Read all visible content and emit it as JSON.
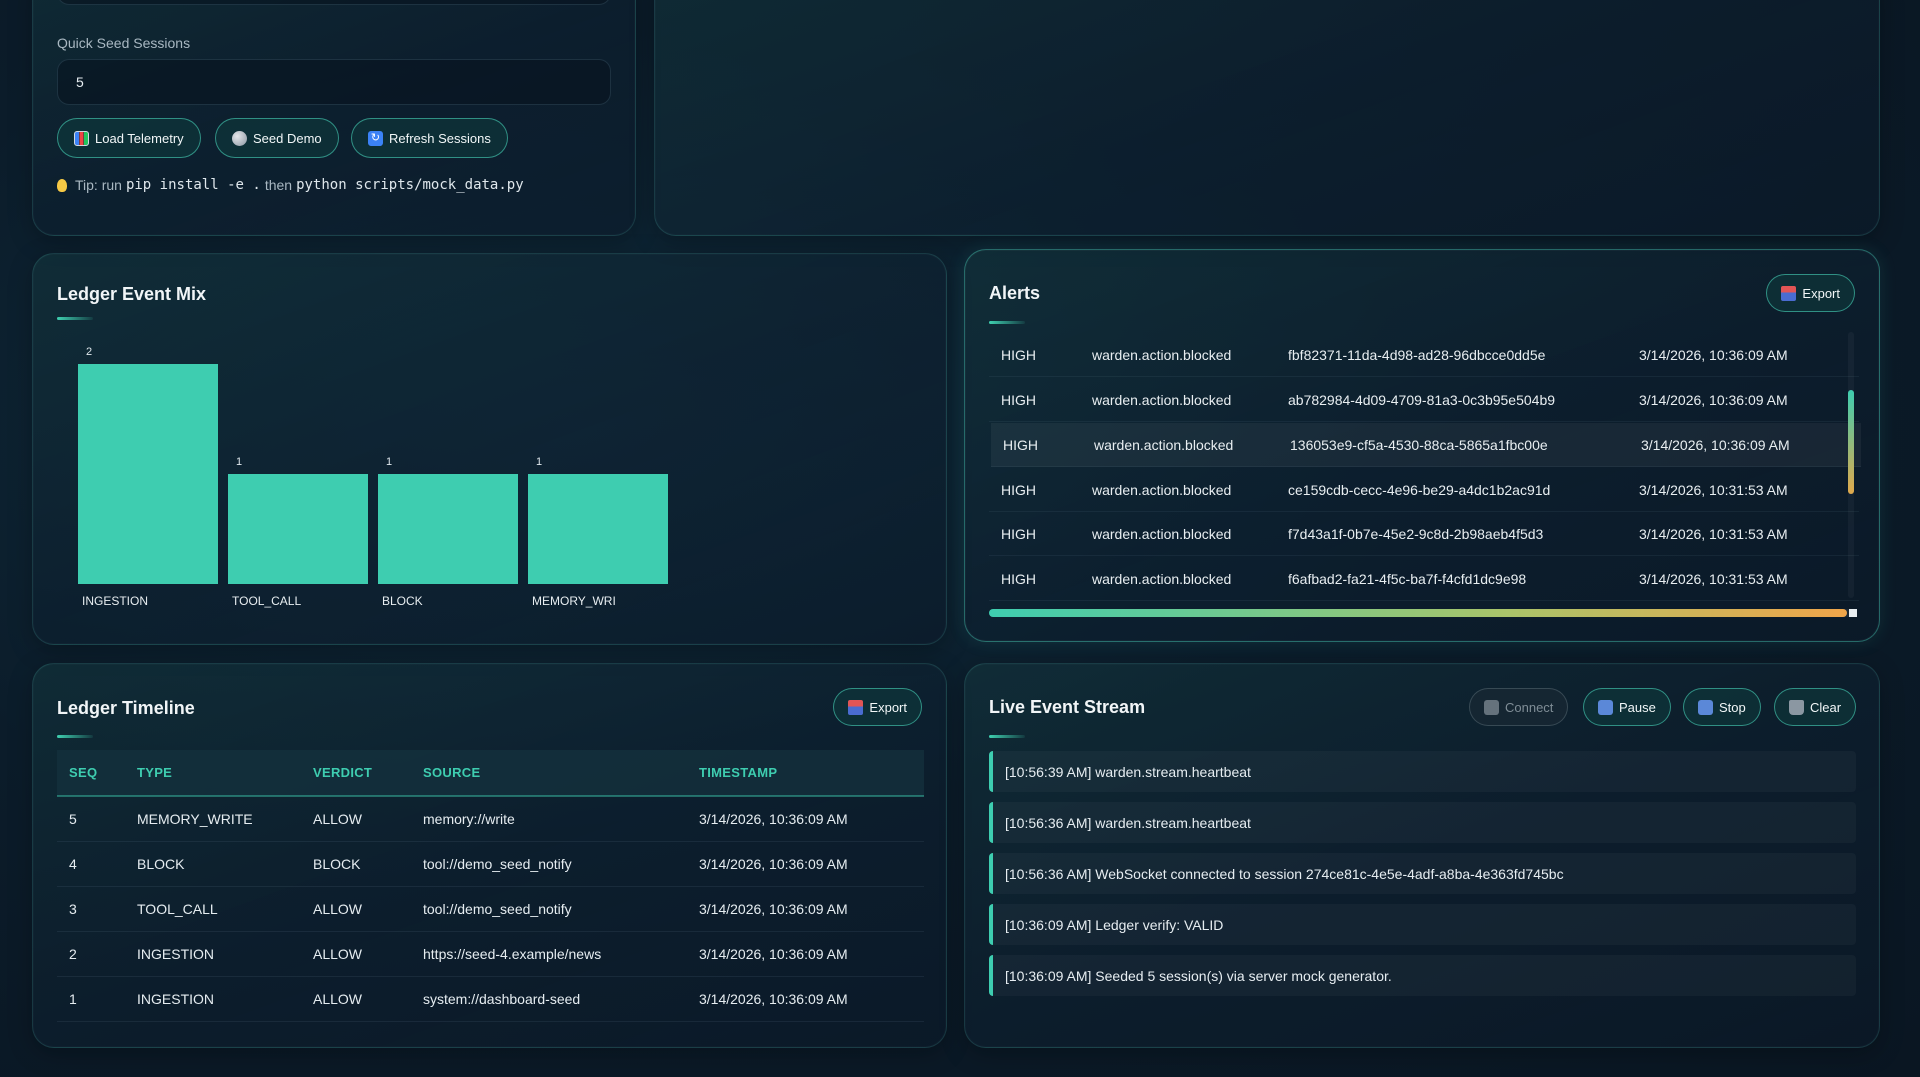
{
  "config": {
    "session_id_partial": "274ce81c-4e5e-4adf-a8ba-4e363fd745bc",
    "quick_seed_label": "Quick Seed Sessions",
    "quick_seed_value": "5",
    "buttons": {
      "load": "Load Telemetry",
      "seed": "Seed Demo",
      "refresh": "Refresh Sessions"
    },
    "tip": {
      "prefix": "Tip: run",
      "cmd1": "pip install -e .",
      "then": "then",
      "cmd2": "python scripts/mock_data.py"
    }
  },
  "ledger_mix": {
    "title": "Ledger Event Mix"
  },
  "chart_data": {
    "type": "bar",
    "categories": [
      "INGESTION",
      "TOOL_CALL",
      "BLOCK",
      "MEMORY_WRI"
    ],
    "values": [
      2,
      1,
      1,
      1
    ],
    "title": "Ledger Event Mix",
    "ylim": [
      0,
      2
    ],
    "grid": false,
    "color": "#3ecdb0"
  },
  "alerts": {
    "title": "Alerts",
    "export": "Export",
    "rows": [
      {
        "severity": "HIGH",
        "event": "warden.action.blocked",
        "id": "fbf82371-11da-4d98-ad28-96dbcce0dd5e",
        "time": "3/14/2026, 10:36:09 AM"
      },
      {
        "severity": "HIGH",
        "event": "warden.action.blocked",
        "id": "ab782984-4d09-4709-81a3-0c3b95e504b9",
        "time": "3/14/2026, 10:36:09 AM"
      },
      {
        "severity": "HIGH",
        "event": "warden.action.blocked",
        "id": "136053e9-cf5a-4530-88ca-5865a1fbc00e",
        "time": "3/14/2026, 10:36:09 AM"
      },
      {
        "severity": "HIGH",
        "event": "warden.action.blocked",
        "id": "ce159cdb-cecc-4e96-be29-a4dc1b2ac91d",
        "time": "3/14/2026, 10:31:53 AM"
      },
      {
        "severity": "HIGH",
        "event": "warden.action.blocked",
        "id": "f7d43a1f-0b7e-45e2-9c8d-2b98aeb4f5d3",
        "time": "3/14/2026, 10:31:53 AM"
      },
      {
        "severity": "HIGH",
        "event": "warden.action.blocked",
        "id": "f6afbad2-fa21-4f5c-ba7f-f4cfd1dc9e98",
        "time": "3/14/2026, 10:31:53 AM"
      }
    ]
  },
  "timeline": {
    "title": "Ledger Timeline",
    "export": "Export",
    "headers": [
      "SEQ",
      "TYPE",
      "VERDICT",
      "SOURCE",
      "TIMESTAMP"
    ],
    "rows": [
      [
        "5",
        "MEMORY_WRITE",
        "ALLOW",
        "memory://write",
        "3/14/2026, 10:36:09 AM"
      ],
      [
        "4",
        "BLOCK",
        "BLOCK",
        "tool://demo_seed_notify",
        "3/14/2026, 10:36:09 AM"
      ],
      [
        "3",
        "TOOL_CALL",
        "ALLOW",
        "tool://demo_seed_notify",
        "3/14/2026, 10:36:09 AM"
      ],
      [
        "2",
        "INGESTION",
        "ALLOW",
        "https://seed-4.example/news",
        "3/14/2026, 10:36:09 AM"
      ],
      [
        "1",
        "INGESTION",
        "ALLOW",
        "system://dashboard-seed",
        "3/14/2026, 10:36:09 AM"
      ]
    ]
  },
  "stream": {
    "title": "Live Event Stream",
    "buttons": {
      "connect": "Connect",
      "pause": "Pause",
      "stop": "Stop",
      "clear": "Clear"
    },
    "logs": [
      "[10:56:39 AM] warden.stream.heartbeat",
      "[10:56:36 AM] warden.stream.heartbeat",
      "[10:56:36 AM] WebSocket connected to session 274ce81c-4e5e-4adf-a8ba-4e363fd745bc",
      "[10:36:09 AM] Ledger verify: VALID",
      "[10:36:09 AM] Seeded 5 session(s) via server mock generator."
    ]
  }
}
